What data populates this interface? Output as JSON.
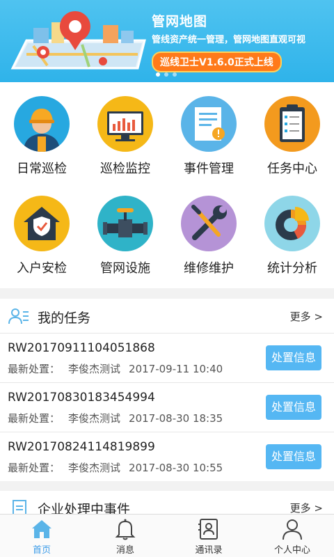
{
  "banner": {
    "title": "管网地图",
    "subtitle": "管线资产统一管理，管网地图直观可视",
    "badge": "巡线卫士V1.6.0正式上线",
    "slides": 3,
    "active_slide": 1
  },
  "grid": {
    "items": [
      {
        "label": "日常巡检",
        "icon": "worker-icon",
        "color": "#27a8e0"
      },
      {
        "label": "巡检监控",
        "icon": "monitor-chart-icon",
        "color": "#f5b817"
      },
      {
        "label": "事件管理",
        "icon": "document-alert-icon",
        "color": "#5ab4e8"
      },
      {
        "label": "任务中心",
        "icon": "clipboard-icon",
        "color": "#f39a1e"
      },
      {
        "label": "入户安检",
        "icon": "house-shield-icon",
        "color": "#f5b817"
      },
      {
        "label": "管网设施",
        "icon": "pipe-valve-icon",
        "color": "#2fb3c8"
      },
      {
        "label": "维修维护",
        "icon": "wrench-screwdriver-icon",
        "color": "#b593d6"
      },
      {
        "label": "统计分析",
        "icon": "donut-chart-icon",
        "color": "#8ed6e8"
      }
    ]
  },
  "tasks": {
    "title": "我的任务",
    "more": "更多 >",
    "items": [
      {
        "id": "RW20170911104051868",
        "label": "最新处置：",
        "person": "李俊杰测试",
        "time": "2017-09-11 10:40",
        "button": "处置信息"
      },
      {
        "id": "RW20170830183454994",
        "label": "最新处置：",
        "person": "李俊杰测试",
        "time": "2017-08-30 18:35",
        "button": "处置信息"
      },
      {
        "id": "RW20170824114819899",
        "label": "最新处置：",
        "person": "李俊杰测试",
        "time": "2017-08-30 10:55",
        "button": "处置信息"
      }
    ]
  },
  "events": {
    "title": "企业处理中事件",
    "more": "更多 >"
  },
  "nav": {
    "items": [
      {
        "label": "首页",
        "icon": "home-icon",
        "active": true
      },
      {
        "label": "消息",
        "icon": "bell-icon",
        "active": false
      },
      {
        "label": "通讯录",
        "icon": "contacts-icon",
        "active": false
      },
      {
        "label": "个人中心",
        "icon": "user-icon",
        "active": false
      }
    ]
  },
  "colors": {
    "accent": "#3a9be8",
    "button": "#55b7f3",
    "banner": "#2fb3ea",
    "badge": "#ff7a1a"
  }
}
